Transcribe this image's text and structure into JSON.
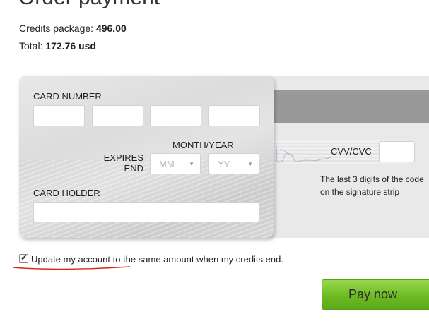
{
  "page": {
    "title": "Order payment"
  },
  "summary": {
    "package_label": "Credits package: ",
    "package_value": "496.00",
    "total_label": "Total: ",
    "total_value": "172.76 usd"
  },
  "card_front": {
    "card_number_label": "CARD NUMBER",
    "month_year_label": "MONTH/YEAR",
    "expires_label": "EXPIRES END",
    "month_placeholder": "MM",
    "year_placeholder": "YY",
    "card_holder_label": "CARD HOLDER"
  },
  "card_back": {
    "cvv_label": "CVV/CVC",
    "cvv_hint": "The last 3 digits of the code on the signature strip"
  },
  "auto_update": {
    "checked": true,
    "label": "Update my account to the same amount when my credits end."
  },
  "actions": {
    "pay_label": "Pay now"
  },
  "colors": {
    "pay_button": "#6cbb24",
    "annotation_underline": "#d9261c",
    "mag_strip": "#999999"
  }
}
